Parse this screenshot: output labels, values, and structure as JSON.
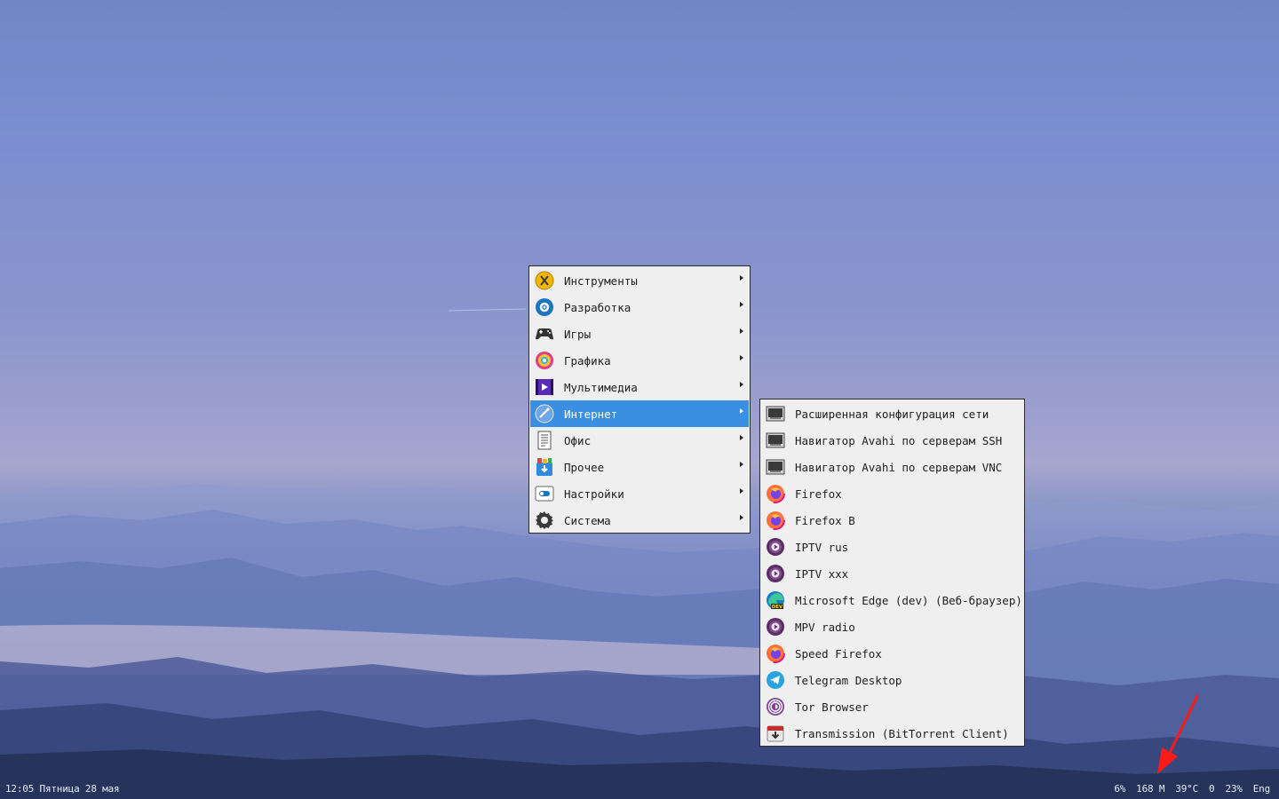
{
  "main_menu": {
    "items": [
      {
        "label": "Инструменты",
        "icon": "tools-icon",
        "active": false
      },
      {
        "label": "Разработка",
        "icon": "development-icon",
        "active": false
      },
      {
        "label": "Игры",
        "icon": "gamepad-icon",
        "active": false
      },
      {
        "label": "Графика",
        "icon": "graphics-icon",
        "active": false
      },
      {
        "label": "Мультимедиа",
        "icon": "multimedia-icon",
        "active": false
      },
      {
        "label": "Интернет",
        "icon": "internet-globe-icon",
        "active": true
      },
      {
        "label": "Офис",
        "icon": "office-document-icon",
        "active": false
      },
      {
        "label": "Прочее",
        "icon": "other-box-icon",
        "active": false
      },
      {
        "label": "Настройки",
        "icon": "settings-toggle-icon",
        "active": false
      },
      {
        "label": "Система",
        "icon": "system-gear-icon",
        "active": false
      }
    ]
  },
  "sub_menu": {
    "items": [
      {
        "label": "Расширенная конфигурация сети",
        "icon": "network-card-icon"
      },
      {
        "label": "Навигатор Avahi по серверам SSH",
        "icon": "network-card-icon"
      },
      {
        "label": "Навигатор Avahi по серверам VNC",
        "icon": "network-card-icon"
      },
      {
        "label": "Firefox",
        "icon": "firefox-icon"
      },
      {
        "label": "Firefox B",
        "icon": "firefox-icon"
      },
      {
        "label": "IPTV rus",
        "icon": "mpv-icon"
      },
      {
        "label": "IPTV xxx",
        "icon": "mpv-icon"
      },
      {
        "label": "Microsoft Edge (dev) (Веб-браузер)",
        "icon": "edge-dev-icon"
      },
      {
        "label": "MPV radio",
        "icon": "mpv-icon"
      },
      {
        "label": "Speed Firefox",
        "icon": "firefox-icon"
      },
      {
        "label": "Telegram Desktop",
        "icon": "telegram-icon"
      },
      {
        "label": "Tor Browser",
        "icon": "tor-icon"
      },
      {
        "label": "Transmission (BitTorrent Client)",
        "icon": "transmission-icon"
      }
    ]
  },
  "taskbar": {
    "clock": "12:05 Пятница 28 мая",
    "tray": [
      "6%",
      "168 M",
      "39°C",
      "0",
      "23%",
      "Eng"
    ]
  },
  "annotation": {
    "icon": "red-arrow-icon",
    "color": "#ff1a1a"
  },
  "colors": {
    "menu_bg": "#efefef",
    "highlight": "#3b8fe3",
    "border": "#2a2a2a"
  }
}
